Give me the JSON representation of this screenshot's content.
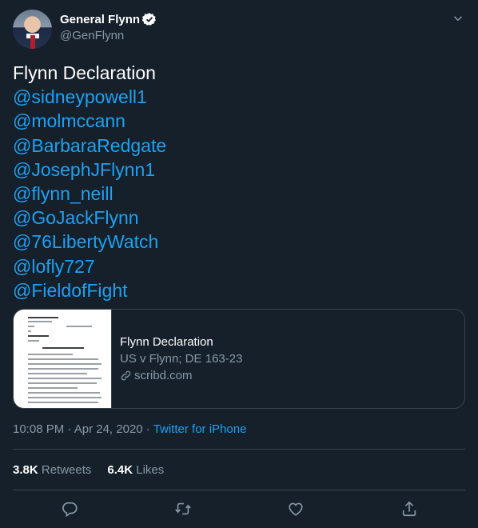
{
  "author": {
    "display_name": "General Flynn",
    "handle": "@GenFlynn",
    "verified": true
  },
  "tweet": {
    "lines": [
      "Flynn Declaration",
      "@sidneypowell1",
      "@molmccann",
      "@BarbaraRedgate",
      "@JosephJFlynn1",
      "@flynn_neill",
      "@GoJackFlynn",
      "@76LibertyWatch",
      "@lofly727",
      "@FieldofFight"
    ]
  },
  "card": {
    "title": "Flynn Declaration",
    "description": "US v Flynn; DE 163-23",
    "domain": "scribd.com"
  },
  "meta": {
    "time": "10:08 PM",
    "separator1": " · ",
    "date": "Apr 24, 2020",
    "separator2": " · ",
    "source": "Twitter for iPhone"
  },
  "stats": {
    "retweets_count": "3.8K",
    "retweets_label": "Retweets",
    "likes_count": "6.4K",
    "likes_label": "Likes"
  },
  "colors": {
    "background": "#15202b",
    "link": "#1da1f2",
    "secondary_text": "#8899a6",
    "border": "#38444d"
  },
  "icons": [
    "verified-icon",
    "chevron-down-icon",
    "link-icon",
    "reply-icon",
    "retweet-icon",
    "like-icon",
    "share-icon"
  ]
}
